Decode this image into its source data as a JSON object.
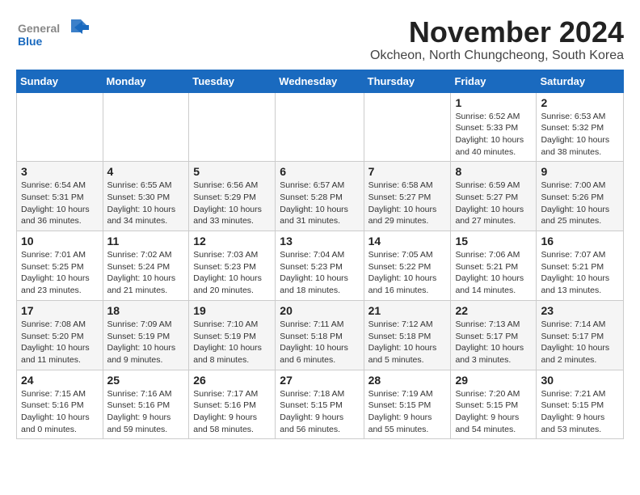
{
  "logo": {
    "general": "General",
    "blue": "Blue"
  },
  "title": "November 2024",
  "subtitle": "Okcheon, North Chungcheong, South Korea",
  "days_of_week": [
    "Sunday",
    "Monday",
    "Tuesday",
    "Wednesday",
    "Thursday",
    "Friday",
    "Saturday"
  ],
  "weeks": [
    [
      {
        "day": "",
        "info": ""
      },
      {
        "day": "",
        "info": ""
      },
      {
        "day": "",
        "info": ""
      },
      {
        "day": "",
        "info": ""
      },
      {
        "day": "",
        "info": ""
      },
      {
        "day": "1",
        "info": "Sunrise: 6:52 AM\nSunset: 5:33 PM\nDaylight: 10 hours\nand 40 minutes."
      },
      {
        "day": "2",
        "info": "Sunrise: 6:53 AM\nSunset: 5:32 PM\nDaylight: 10 hours\nand 38 minutes."
      }
    ],
    [
      {
        "day": "3",
        "info": "Sunrise: 6:54 AM\nSunset: 5:31 PM\nDaylight: 10 hours\nand 36 minutes."
      },
      {
        "day": "4",
        "info": "Sunrise: 6:55 AM\nSunset: 5:30 PM\nDaylight: 10 hours\nand 34 minutes."
      },
      {
        "day": "5",
        "info": "Sunrise: 6:56 AM\nSunset: 5:29 PM\nDaylight: 10 hours\nand 33 minutes."
      },
      {
        "day": "6",
        "info": "Sunrise: 6:57 AM\nSunset: 5:28 PM\nDaylight: 10 hours\nand 31 minutes."
      },
      {
        "day": "7",
        "info": "Sunrise: 6:58 AM\nSunset: 5:27 PM\nDaylight: 10 hours\nand 29 minutes."
      },
      {
        "day": "8",
        "info": "Sunrise: 6:59 AM\nSunset: 5:27 PM\nDaylight: 10 hours\nand 27 minutes."
      },
      {
        "day": "9",
        "info": "Sunrise: 7:00 AM\nSunset: 5:26 PM\nDaylight: 10 hours\nand 25 minutes."
      }
    ],
    [
      {
        "day": "10",
        "info": "Sunrise: 7:01 AM\nSunset: 5:25 PM\nDaylight: 10 hours\nand 23 minutes."
      },
      {
        "day": "11",
        "info": "Sunrise: 7:02 AM\nSunset: 5:24 PM\nDaylight: 10 hours\nand 21 minutes."
      },
      {
        "day": "12",
        "info": "Sunrise: 7:03 AM\nSunset: 5:23 PM\nDaylight: 10 hours\nand 20 minutes."
      },
      {
        "day": "13",
        "info": "Sunrise: 7:04 AM\nSunset: 5:23 PM\nDaylight: 10 hours\nand 18 minutes."
      },
      {
        "day": "14",
        "info": "Sunrise: 7:05 AM\nSunset: 5:22 PM\nDaylight: 10 hours\nand 16 minutes."
      },
      {
        "day": "15",
        "info": "Sunrise: 7:06 AM\nSunset: 5:21 PM\nDaylight: 10 hours\nand 14 minutes."
      },
      {
        "day": "16",
        "info": "Sunrise: 7:07 AM\nSunset: 5:21 PM\nDaylight: 10 hours\nand 13 minutes."
      }
    ],
    [
      {
        "day": "17",
        "info": "Sunrise: 7:08 AM\nSunset: 5:20 PM\nDaylight: 10 hours\nand 11 minutes."
      },
      {
        "day": "18",
        "info": "Sunrise: 7:09 AM\nSunset: 5:19 PM\nDaylight: 10 hours\nand 9 minutes."
      },
      {
        "day": "19",
        "info": "Sunrise: 7:10 AM\nSunset: 5:19 PM\nDaylight: 10 hours\nand 8 minutes."
      },
      {
        "day": "20",
        "info": "Sunrise: 7:11 AM\nSunset: 5:18 PM\nDaylight: 10 hours\nand 6 minutes."
      },
      {
        "day": "21",
        "info": "Sunrise: 7:12 AM\nSunset: 5:18 PM\nDaylight: 10 hours\nand 5 minutes."
      },
      {
        "day": "22",
        "info": "Sunrise: 7:13 AM\nSunset: 5:17 PM\nDaylight: 10 hours\nand 3 minutes."
      },
      {
        "day": "23",
        "info": "Sunrise: 7:14 AM\nSunset: 5:17 PM\nDaylight: 10 hours\nand 2 minutes."
      }
    ],
    [
      {
        "day": "24",
        "info": "Sunrise: 7:15 AM\nSunset: 5:16 PM\nDaylight: 10 hours\nand 0 minutes."
      },
      {
        "day": "25",
        "info": "Sunrise: 7:16 AM\nSunset: 5:16 PM\nDaylight: 9 hours\nand 59 minutes."
      },
      {
        "day": "26",
        "info": "Sunrise: 7:17 AM\nSunset: 5:16 PM\nDaylight: 9 hours\nand 58 minutes."
      },
      {
        "day": "27",
        "info": "Sunrise: 7:18 AM\nSunset: 5:15 PM\nDaylight: 9 hours\nand 56 minutes."
      },
      {
        "day": "28",
        "info": "Sunrise: 7:19 AM\nSunset: 5:15 PM\nDaylight: 9 hours\nand 55 minutes."
      },
      {
        "day": "29",
        "info": "Sunrise: 7:20 AM\nSunset: 5:15 PM\nDaylight: 9 hours\nand 54 minutes."
      },
      {
        "day": "30",
        "info": "Sunrise: 7:21 AM\nSunset: 5:15 PM\nDaylight: 9 hours\nand 53 minutes."
      }
    ]
  ]
}
